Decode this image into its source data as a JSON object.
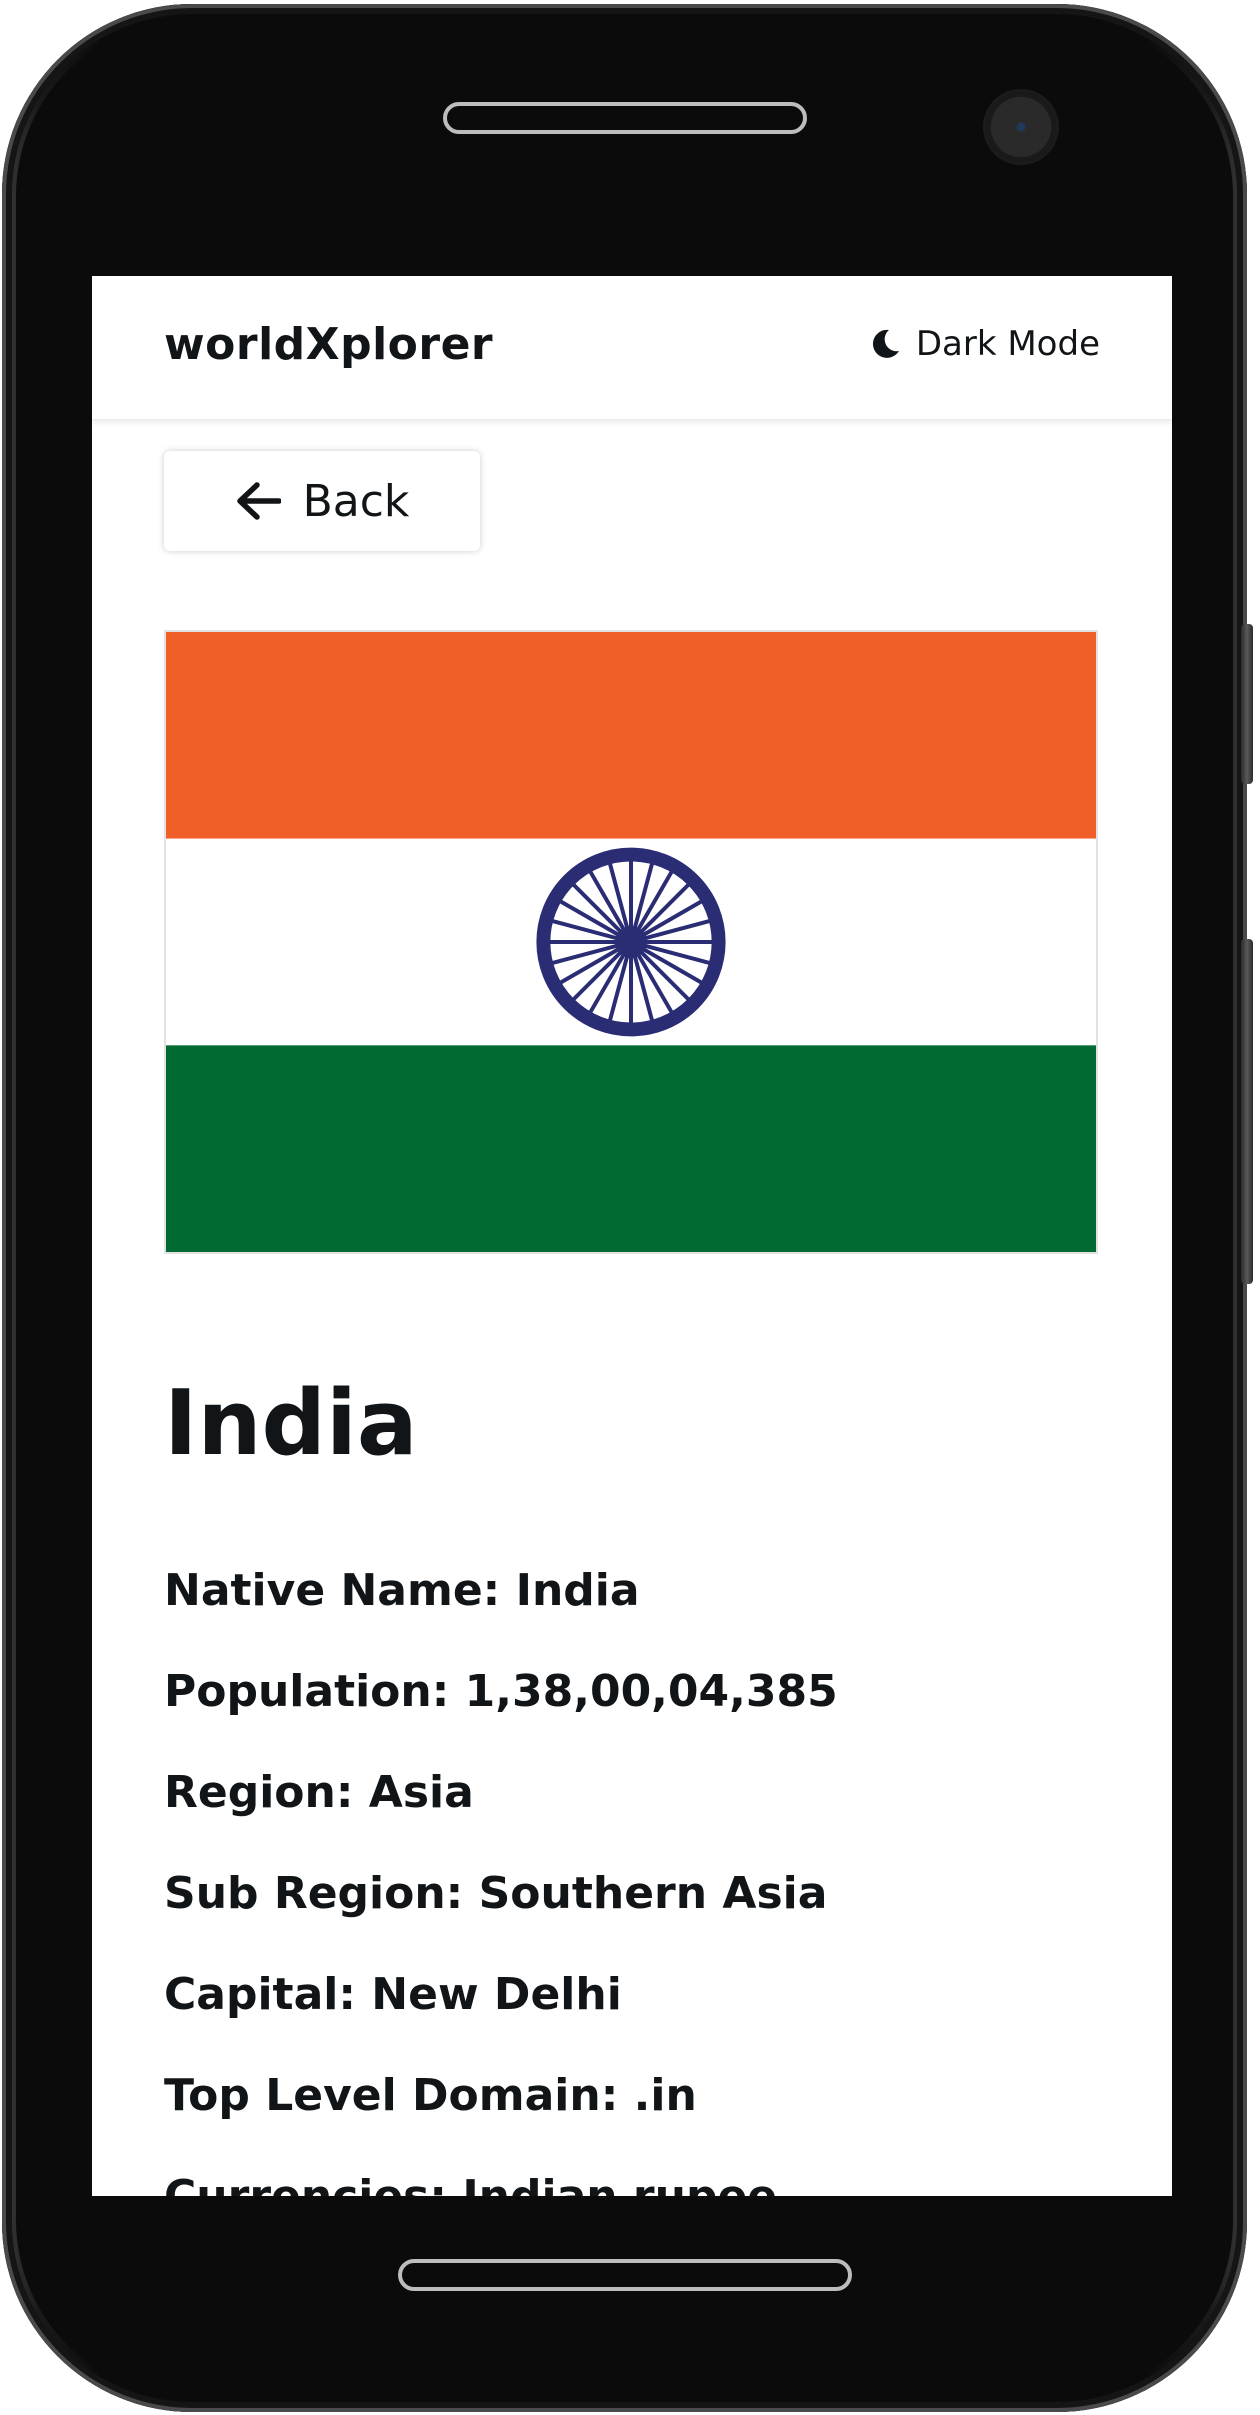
{
  "app": {
    "title": "worldXplorer",
    "dark_mode_label": "Dark Mode"
  },
  "back_button": {
    "label": "Back"
  },
  "flag": {
    "colors": {
      "saffron": "#F15F29",
      "white": "#FFFFFF",
      "green": "#006A32",
      "chakra_blue": "#2A2C74"
    }
  },
  "country": {
    "name": "India",
    "details": [
      {
        "label": "Native Name:",
        "value": "India"
      },
      {
        "label": "Population:",
        "value": "1,38,00,04,385"
      },
      {
        "label": "Region:",
        "value": "Asia"
      },
      {
        "label": "Sub Region:",
        "value": "Southern Asia"
      },
      {
        "label": "Capital:",
        "value": "New Delhi"
      },
      {
        "label": "Top Level Domain:",
        "value": ".in"
      },
      {
        "label": "Currencies:",
        "value": "Indian rupee"
      }
    ]
  },
  "icons": {
    "dark_mode": "moon-icon",
    "back": "arrow-left-icon"
  }
}
